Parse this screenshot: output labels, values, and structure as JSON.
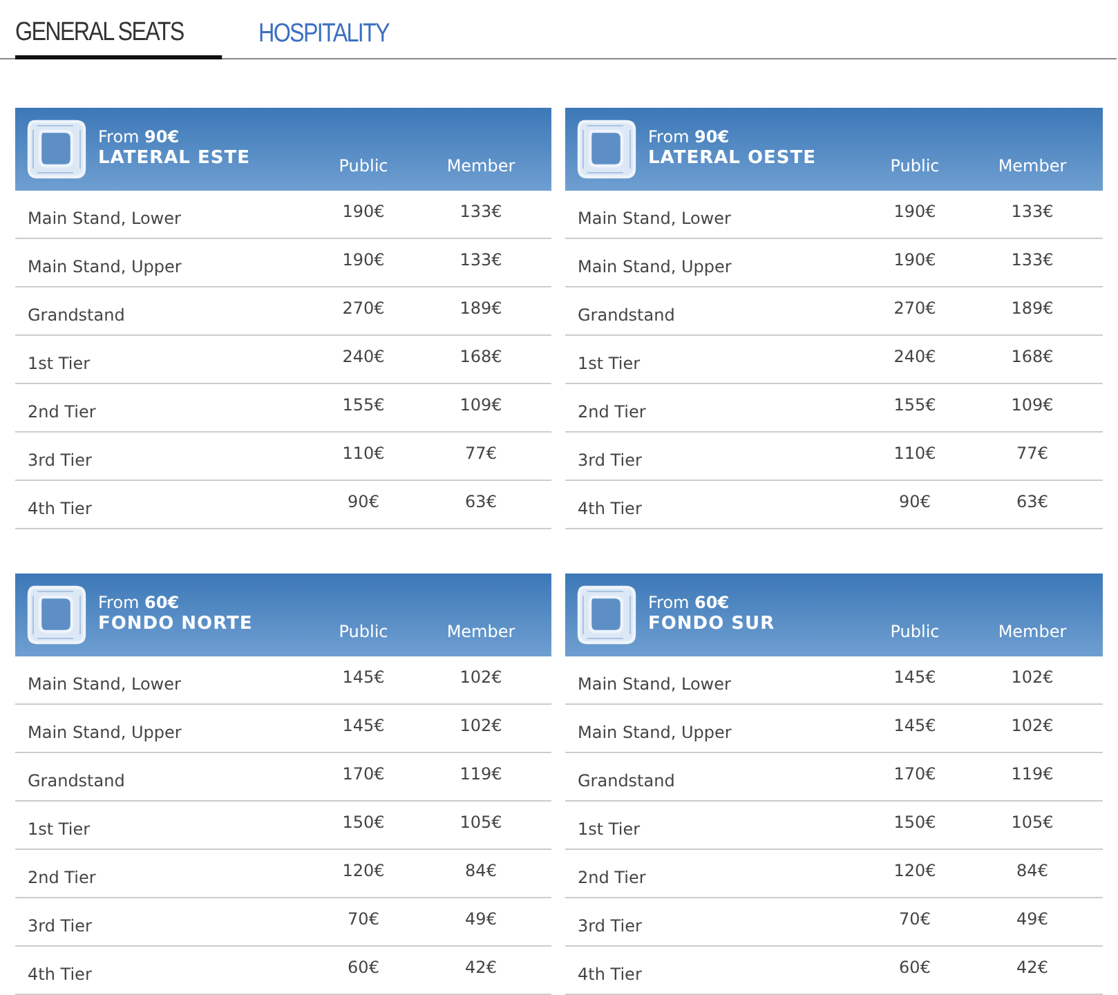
{
  "tabs": [
    {
      "label": "GENERAL SEATS",
      "selected": true
    },
    {
      "label": "HOSPITALITY",
      "selected": false
    }
  ],
  "sections": [
    {
      "from": "From **90€**",
      "title": "LATERAL ESTE",
      "public_heading": "Public",
      "member_heading": "Member",
      "rows": [
        {
          "area": "Main Stand, Lower",
          "public": "190€",
          "member": "133€"
        },
        {
          "area": "Main Stand, Upper",
          "public": "190€",
          "member": "133€"
        },
        {
          "area": "Grandstand",
          "public": "270€",
          "member": "189€"
        },
        {
          "area": "1st Tier",
          "public": "240€",
          "member": "168€"
        },
        {
          "area": "2nd Tier",
          "public": "155€",
          "member": "109€"
        },
        {
          "area": "3rd Tier",
          "public": "110€",
          "member": "77€"
        },
        {
          "area": "4th Tier",
          "public": "90€",
          "member": "63€"
        }
      ]
    },
    {
      "from": "From **90€**",
      "title": "LATERAL OESTE",
      "public_heading": "Public",
      "member_heading": "Member",
      "rows": [
        {
          "area": "Main Stand, Lower",
          "public": "190€",
          "member": "133€"
        },
        {
          "area": "Main Stand, Upper",
          "public": "190€",
          "member": "133€"
        },
        {
          "area": "Grandstand",
          "public": "270€",
          "member": "189€"
        },
        {
          "area": "1st Tier",
          "public": "240€",
          "member": "168€"
        },
        {
          "area": "2nd Tier",
          "public": "155€",
          "member": "109€"
        },
        {
          "area": "3rd Tier",
          "public": "110€",
          "member": "77€"
        },
        {
          "area": "4th Tier",
          "public": "90€",
          "member": "63€"
        }
      ]
    },
    {
      "from": "From **60€**",
      "title": "FONDO NORTE",
      "public_heading": "Public",
      "member_heading": "Member",
      "rows": [
        {
          "area": "Main Stand, Lower",
          "public": "145€",
          "member": "102€"
        },
        {
          "area": "Main Stand, Upper",
          "public": "145€",
          "member": "102€"
        },
        {
          "area": "Grandstand",
          "public": "170€",
          "member": "119€"
        },
        {
          "area": "1st Tier",
          "public": "150€",
          "member": "105€"
        },
        {
          "area": "2nd Tier",
          "public": "120€",
          "member": "84€"
        },
        {
          "area": "3rd Tier",
          "public": "70€",
          "member": "49€"
        },
        {
          "area": "4th Tier",
          "public": "60€",
          "member": "42€"
        }
      ]
    },
    {
      "from": "From **60€**",
      "title": "FONDO SUR",
      "public_heading": "Public",
      "member_heading": "Member",
      "rows": [
        {
          "area": "Main Stand, Lower",
          "public": "145€",
          "member": "102€"
        },
        {
          "area": "Main Stand, Upper",
          "public": "145€",
          "member": "102€"
        },
        {
          "area": "Grandstand",
          "public": "170€",
          "member": "119€"
        },
        {
          "area": "1st Tier",
          "public": "150€",
          "member": "105€"
        },
        {
          "area": "2nd Tier",
          "public": "120€",
          "member": "84€"
        },
        {
          "area": "3rd Tier",
          "public": "70€",
          "member": "49€"
        },
        {
          "area": "4th Tier",
          "public": "60€",
          "member": "42€"
        }
      ]
    }
  ]
}
